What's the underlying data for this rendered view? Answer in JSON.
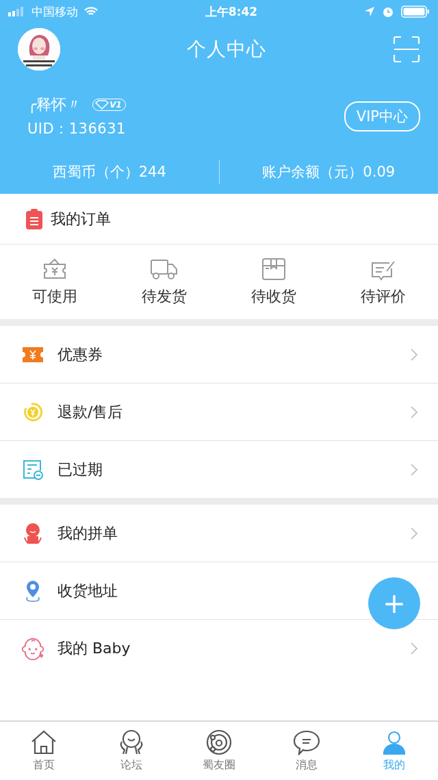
{
  "status_bar": {
    "carrier": "中国移动",
    "time": "上午8:42"
  },
  "header": {
    "title": "个人中心",
    "username": "╭释怀〃",
    "level_badge": "V1",
    "uid": "UID：136631",
    "vip_button": "VIP中心",
    "stats": [
      "西蜀币（个）244",
      "账户余额（元）0.09"
    ]
  },
  "orders": {
    "title": "我的订单",
    "states": [
      "可使用",
      "待发货",
      "待收货",
      "待评价"
    ]
  },
  "groups": [
    [
      {
        "label": "优惠券",
        "chevron": true
      },
      {
        "label": "退款/售后",
        "chevron": true
      },
      {
        "label": "已过期",
        "chevron": true
      }
    ],
    [
      {
        "label": "我的拼单",
        "chevron": true
      },
      {
        "label": "收货地址",
        "chevron": false
      },
      {
        "label": "我的 Baby",
        "chevron": true
      }
    ]
  ],
  "fab": "+",
  "tabs": [
    {
      "label": "首页",
      "selected": false
    },
    {
      "label": "论坛",
      "selected": false
    },
    {
      "label": "蜀友圈",
      "selected": false
    },
    {
      "label": "消息",
      "selected": false
    },
    {
      "label": "我的",
      "selected": true
    }
  ]
}
